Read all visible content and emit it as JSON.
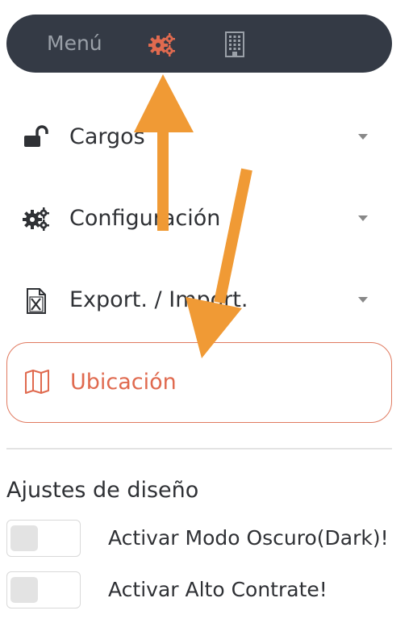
{
  "topbar": {
    "menu_label": "Menú",
    "icons": [
      "gears-icon",
      "building-icon"
    ],
    "active_color": "#e06a4f",
    "background": "#343a45"
  },
  "menu": {
    "items": [
      {
        "label": "Cargos",
        "icon": "unlock-icon",
        "expandable": true
      },
      {
        "label": "Configuración",
        "icon": "gears-icon",
        "expandable": true
      },
      {
        "label": "Export. / Import.",
        "icon": "excel-file-icon",
        "expandable": true
      },
      {
        "label": "Ubicación",
        "icon": "map-icon",
        "active": true
      }
    ]
  },
  "design_settings": {
    "title": "Ajustes de diseño",
    "toggles": [
      {
        "label": "Activar Modo Oscuro(Dark)!",
        "on": false
      },
      {
        "label": "Activar Alto Contrate!",
        "on": false
      }
    ]
  },
  "annotation_color": "#f09a35"
}
